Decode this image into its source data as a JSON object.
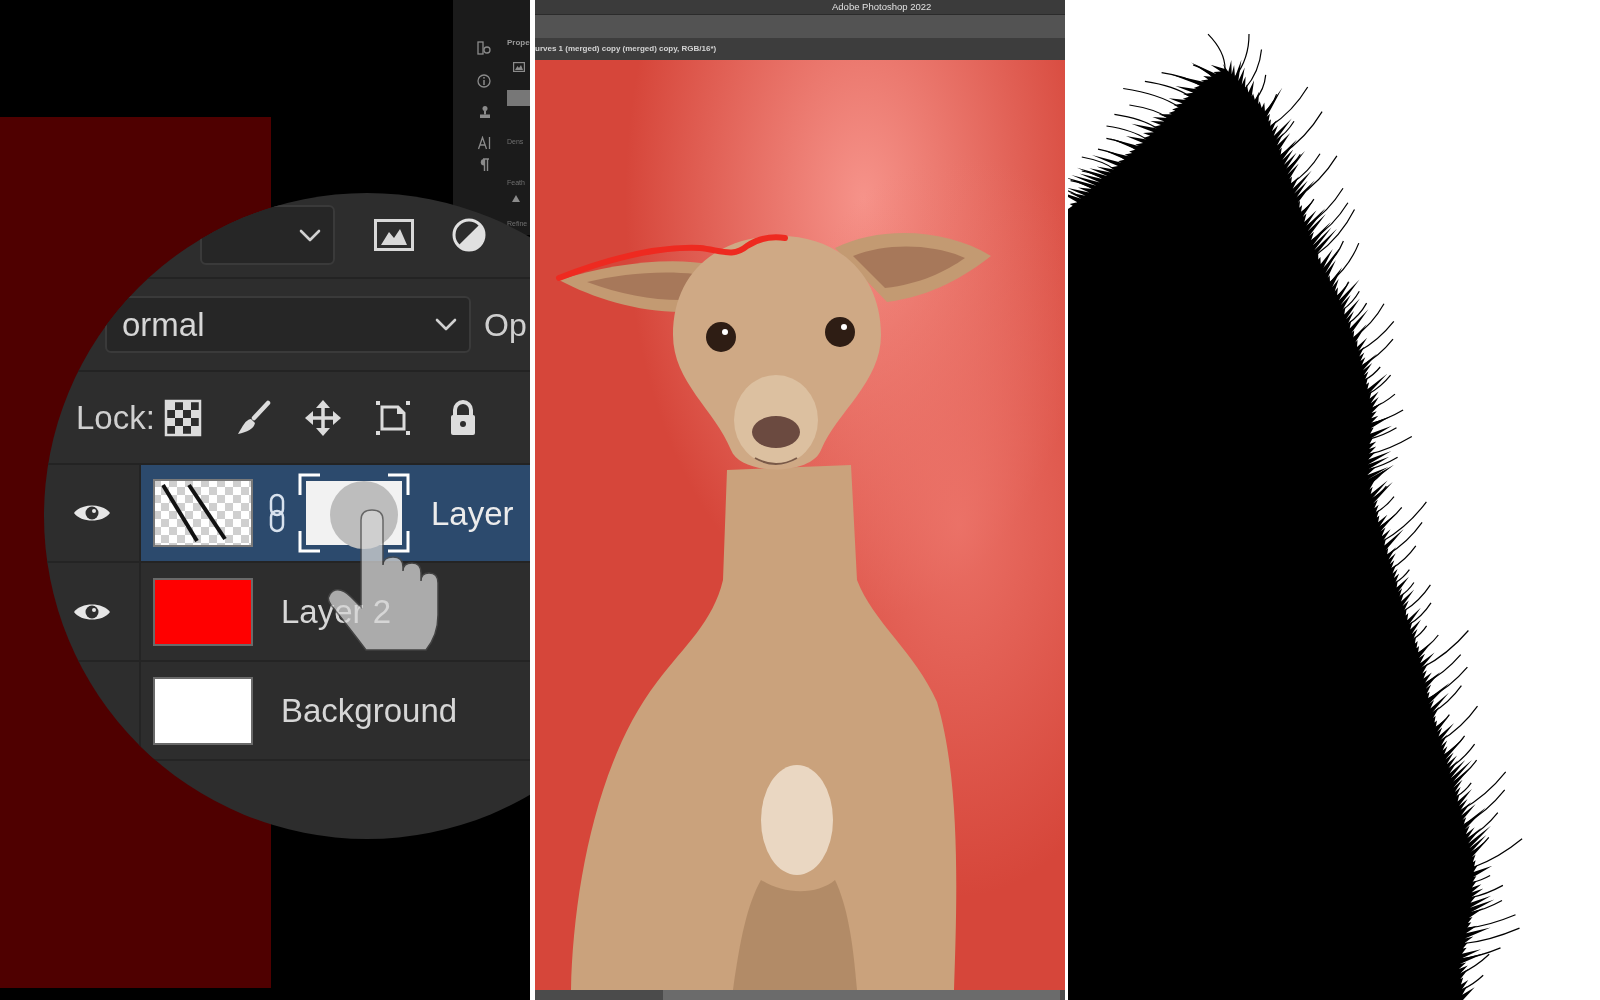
{
  "workspace": {
    "properties_panel": {
      "heading": "Prope",
      "labels": [
        "Dens",
        "Feath",
        "Refine"
      ]
    },
    "layers_panel": {
      "blend_mode": "ormal",
      "opacity_label": "Op",
      "lock_label": "Lock:",
      "layers": [
        {
          "kind": "masked",
          "name": "Layer",
          "visible": true,
          "selected": true
        },
        {
          "kind": "solid",
          "name": "Layer 2",
          "visible": true,
          "selected": false,
          "color": "#ff0000"
        },
        {
          "kind": "solid",
          "name": "Background",
          "visible": false,
          "selected": false,
          "color": "#ffffff"
        }
      ]
    }
  },
  "photoshop_window": {
    "title": "Adobe Photoshop 2022",
    "document_tab": "urves 1 (merged) copy (merged) copy, RGB/16*)"
  }
}
